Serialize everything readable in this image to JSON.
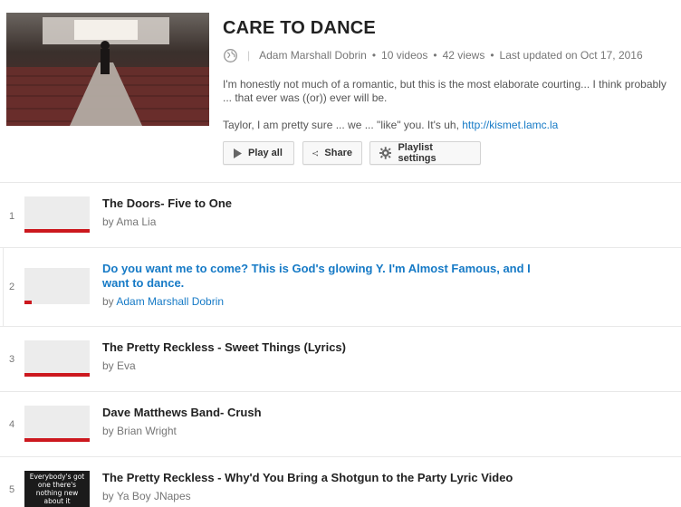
{
  "playlist": {
    "title": "CARE TO DANCE",
    "owner": "Adam Marshall Dobrin",
    "video_count": "10 videos",
    "views": "42 views",
    "updated": "Last updated on Oct 17, 2016",
    "description": "I'm honestly not much of a romantic, but this is the most elaborate courting... I think probably ... that ever was ((or)) ever will be.",
    "description2_prefix": "Taylor, I am pretty sure ... we ... \"like\" you. It's uh, ",
    "description2_link": "http://kismet.lamc.la"
  },
  "buttons": {
    "play_all": "Play all",
    "share": "Share",
    "settings": "Playlist settings"
  },
  "colors": {
    "accent": "#167ac6",
    "progress": "#cc181e"
  },
  "videos": [
    {
      "index": "1",
      "title": "The Doors- Five to One",
      "by": "by",
      "channel": "Ama Lia",
      "progress": 1.0
    },
    {
      "index": "2",
      "title": "Do you want me to come? This is God's glowing Y. I'm Almost Famous, and I want to dance.",
      "by": "by",
      "channel": "Adam Marshall Dobrin",
      "progress": 0.11
    },
    {
      "index": "3",
      "title": "The Pretty Reckless - Sweet Things (Lyrics)",
      "by": "by",
      "channel": "Eva",
      "progress": 1.0
    },
    {
      "index": "4",
      "title": "Dave Matthews Band- Crush",
      "by": "by",
      "channel": "Brian Wright",
      "progress": 1.0
    },
    {
      "index": "5",
      "title": "The Pretty Reckless - Why'd You Bring a Shotgun to the Party Lyric Video",
      "by": "by",
      "channel": "Ya Boy JNapes",
      "thumb_text": "Everybody's got one there's nothing new about it"
    }
  ]
}
